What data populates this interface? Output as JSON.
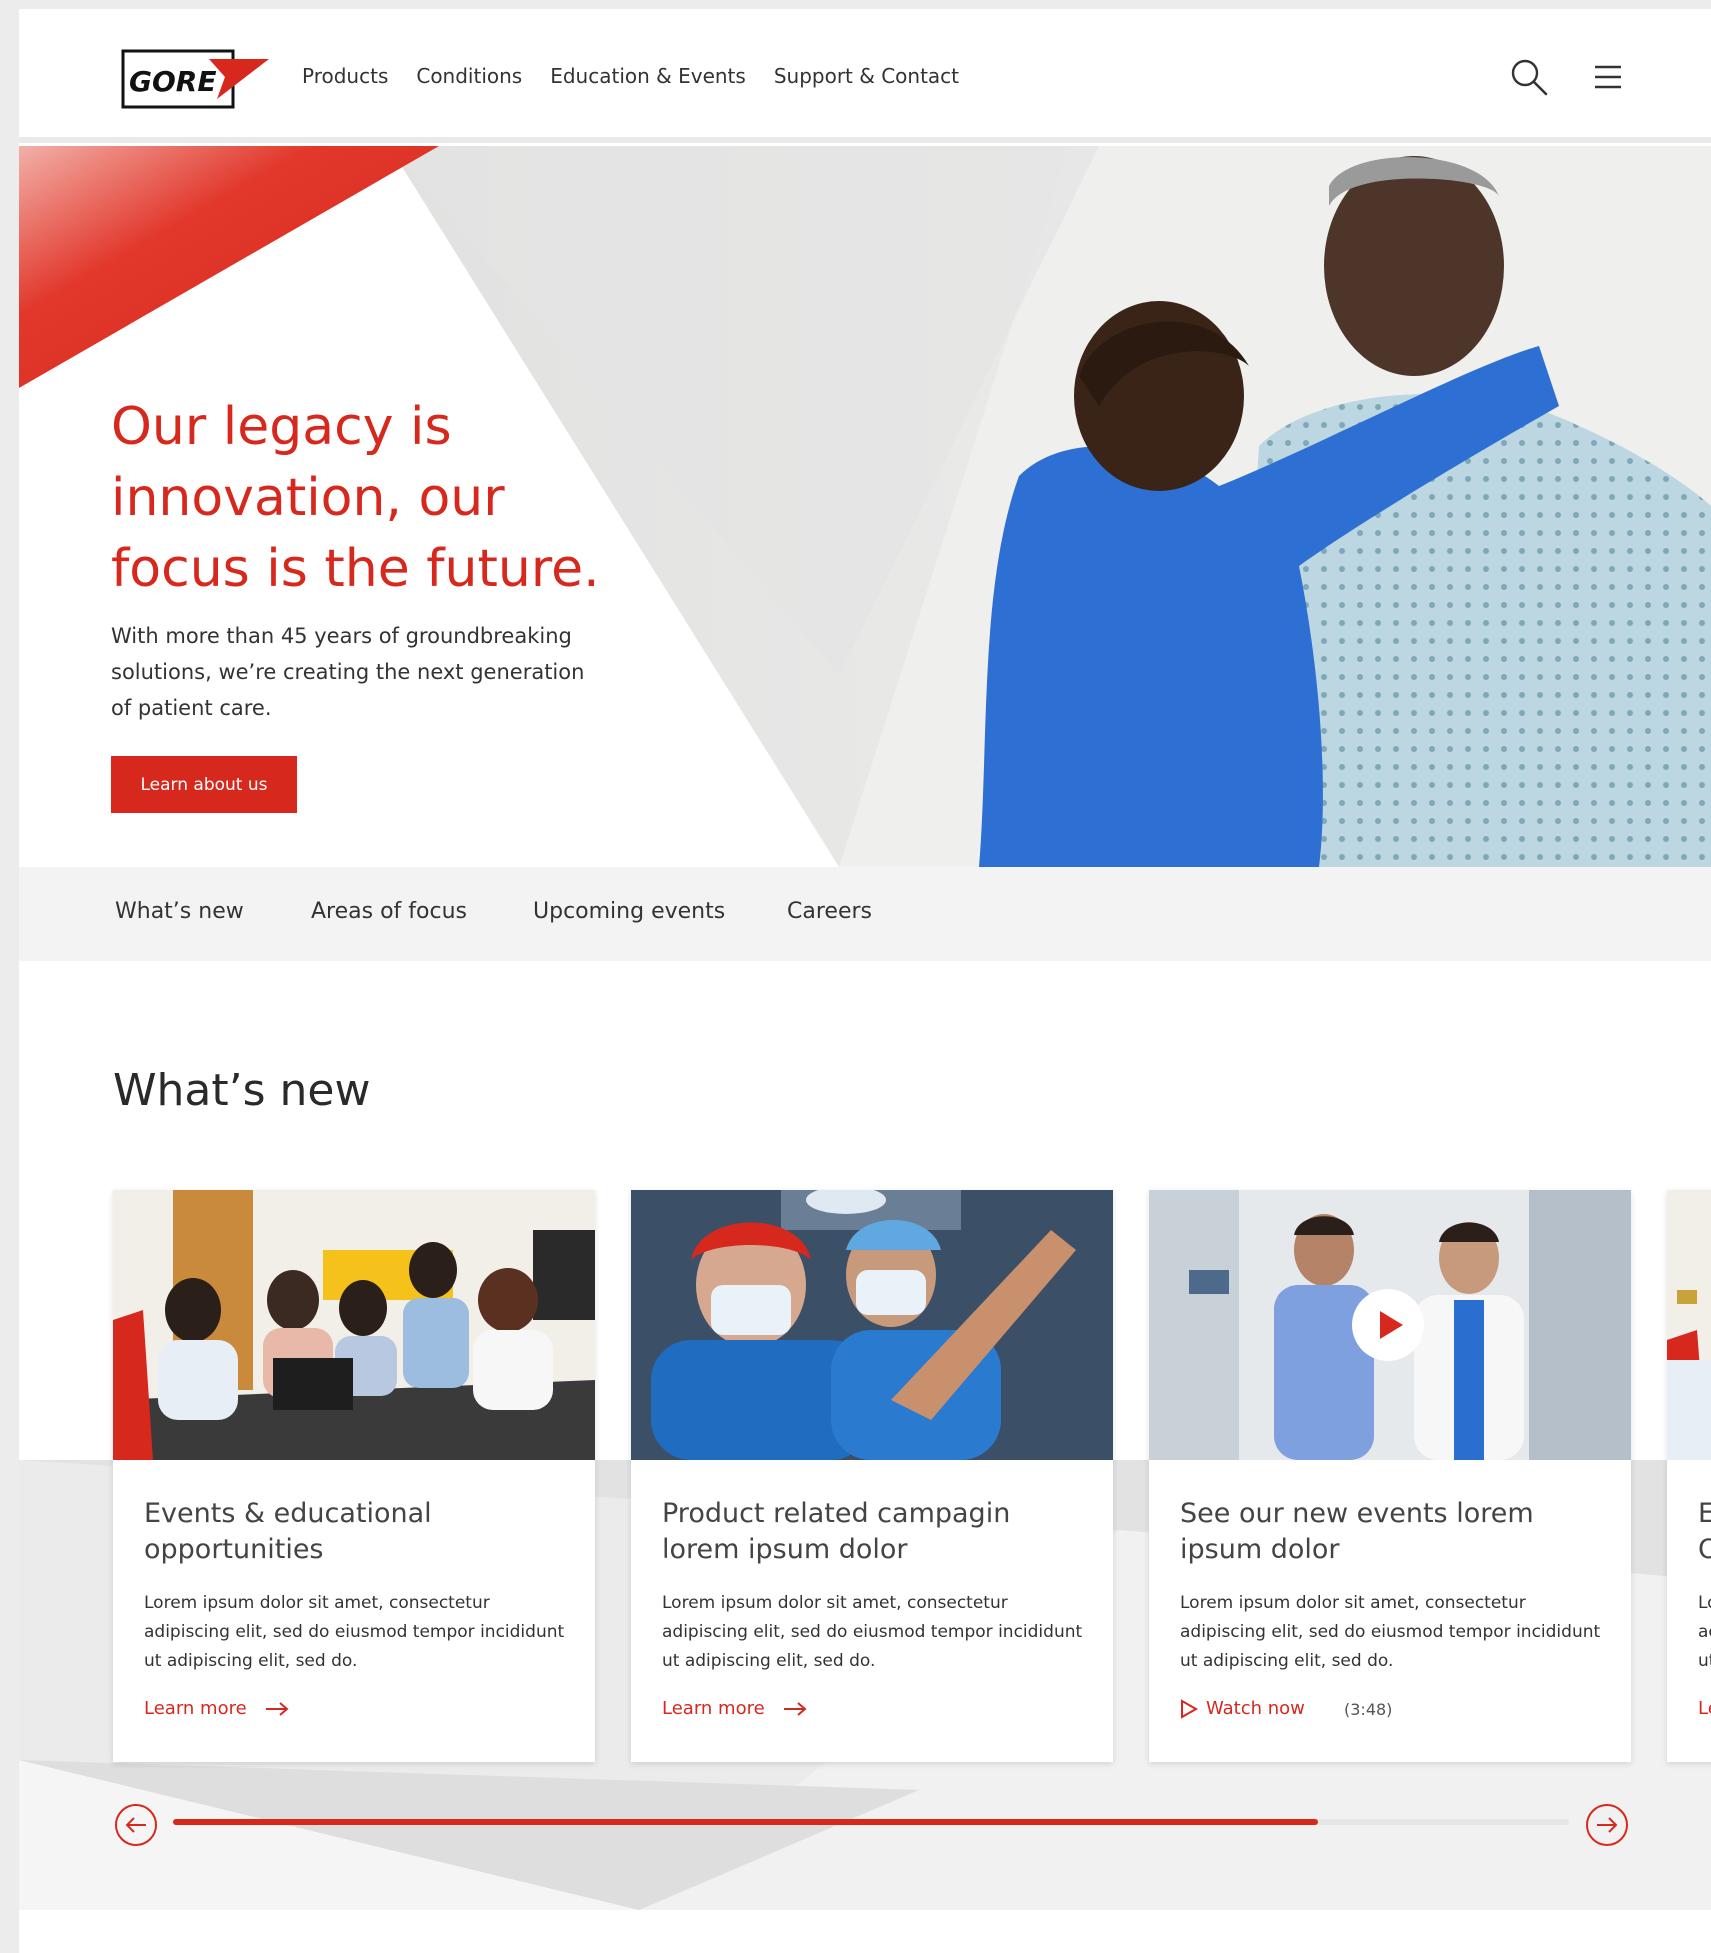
{
  "brand": {
    "logo_text": "GORE",
    "accent_color": "#d7281e"
  },
  "header": {
    "nav": [
      "Products",
      "Conditions",
      "Education & Events",
      "Support & Contact"
    ],
    "search_icon": "search-icon",
    "menu_icon": "hamburger-menu-icon"
  },
  "hero": {
    "title": "Our legacy is innovation, our focus is the future.",
    "text": "With more than 45 years of groundbreaking solutions, we’re creating the next generation of patient care.",
    "button": "Learn about us"
  },
  "subnav": [
    "What’s new",
    "Areas of focus",
    "Upcoming events",
    "Careers"
  ],
  "whats_new": {
    "title": "What’s new",
    "cards": [
      {
        "title": "Events & educational opportunities",
        "text": "Lorem ipsum dolor sit amet, consectetur adipiscing elit, sed do eiusmod tempor incididunt ut adipiscing elit, sed do.",
        "link": "Learn more"
      },
      {
        "title": "Product related campagin lorem ipsum dolor",
        "text": "Lorem ipsum dolor sit amet, consectetur adipiscing elit, sed do eiusmod tempor incididunt ut adipiscing elit, sed do.",
        "link": "Learn more"
      },
      {
        "title": "See our new events lorem ipsum dolor",
        "text": "Lorem ipsum dolor sit amet, consectetur adipiscing elit, sed do eiusmod tempor incididunt ut adipiscing elit, sed do.",
        "link": "Watch now",
        "duration": "(3:48)"
      },
      {
        "title": "E O",
        "text": "Lo ac ut",
        "link": "Le"
      }
    ],
    "slider_progress": 0.82
  }
}
